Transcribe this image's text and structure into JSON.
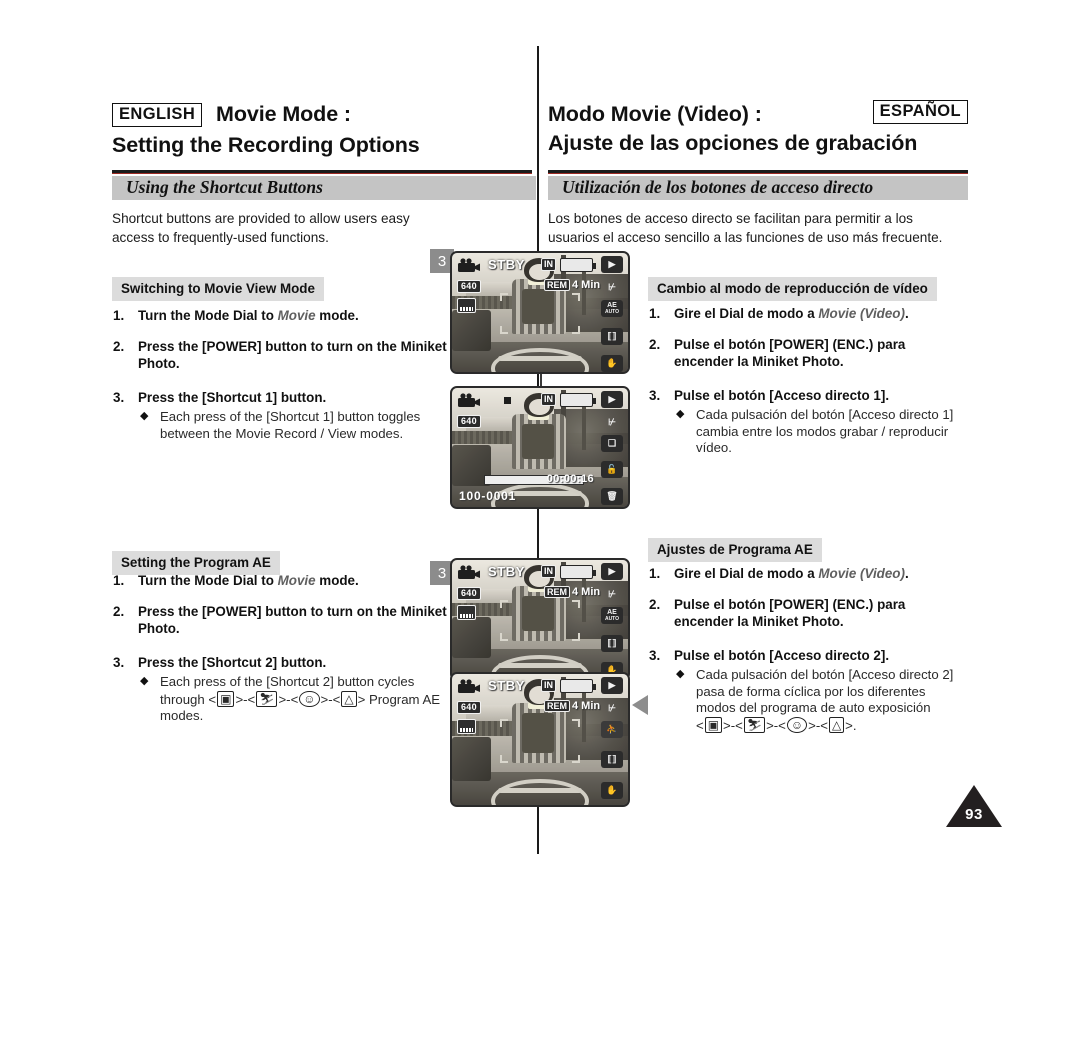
{
  "page": {
    "number": "93"
  },
  "english": {
    "lang_tag": "ENGLISH",
    "title_line1": "Movie Mode :",
    "title_line2": "Setting the Recording Options",
    "section_bar": "Using the Shortcut Buttons",
    "intro": "Shortcut buttons are provided to allow users easy access to frequently-used functions.",
    "sub1": {
      "heading": "Switching to Movie View Mode",
      "steps": [
        {
          "num": "1.",
          "pre": "Turn the Mode Dial to ",
          "em": "Movie",
          "post": " mode."
        },
        {
          "num": "2.",
          "pre": "Press the [POWER] button to turn on the Miniket Photo.",
          "em": "",
          "post": ""
        },
        {
          "num": "3.",
          "pre": "Press the [Shortcut 1] button.",
          "em": "",
          "post": "",
          "bullet": "Each press of the [Shortcut 1] button toggles between the Movie Record / View modes."
        }
      ]
    },
    "sub2": {
      "heading": "Setting the Program AE",
      "steps": [
        {
          "num": "1.",
          "pre": "Turn the Mode Dial to ",
          "em": "Movie",
          "post": " mode."
        },
        {
          "num": "2.",
          "pre": "Press the [POWER] button to turn on the Miniket Photo.",
          "em": "",
          "post": ""
        },
        {
          "num": "3.",
          "pre": "Press the [Shortcut 2] button.",
          "em": "",
          "post": "",
          "bullet_a": "Each press of the [Shortcut 2] button cycles",
          "bullet_b": "through",
          "bullet_c": "Program AE",
          "bullet_d": "modes."
        }
      ]
    }
  },
  "spanish": {
    "lang_tag": "ESPAÑOL",
    "title_line1": "Modo Movie (Video) :",
    "title_line2": "Ajuste de las opciones de grabación",
    "section_bar": "Utilización de los botones de acceso directo",
    "intro": "Los botones de acceso directo se facilitan para permitir a los usuarios el acceso sencillo a las funciones de uso más frecuente.",
    "sub1": {
      "heading": "Cambio al modo de reproducción de vídeo",
      "steps": [
        {
          "num": "1.",
          "pre": "Gire el Dial de modo a ",
          "em": "Movie (Video)",
          "post": "."
        },
        {
          "num": "2.",
          "pre": "Pulse el botón [POWER] (ENC.) para encender la Miniket Photo.",
          "em": "",
          "post": ""
        },
        {
          "num": "3.",
          "pre": "Pulse el botón [Acceso directo 1].",
          "em": "",
          "post": "",
          "bullet": "Cada pulsación del botón [Acceso directo 1] cambia entre los modos grabar / reproducir vídeo."
        }
      ]
    },
    "sub2": {
      "heading": "Ajustes de Programa AE",
      "steps": [
        {
          "num": "1.",
          "pre": "Gire el Dial de modo a ",
          "em": "Movie (Video)",
          "post": "."
        },
        {
          "num": "2.",
          "pre": "Pulse el botón [POWER] (ENC.) para encender la Miniket Photo.",
          "em": "",
          "post": ""
        },
        {
          "num": "3.",
          "pre": "Pulse el botón [Acceso directo 2].",
          "em": "",
          "post": "",
          "bullet_a": "Cada pulsación del botón [Acceso directo 2]",
          "bullet_b": "pasa de forma cíclica por los diferentes",
          "bullet_c": "modos del programa de auto exposición",
          "bullet_d": "."
        }
      ]
    }
  },
  "program_ae_glyphs": {
    "auto": "auto-program-icon",
    "sports": "sports-icon",
    "spotlight": "spotlight-icon",
    "sand_snow": "sand-snow-icon",
    "sep": ">-<",
    "open": "<",
    "close": ">"
  },
  "lcd": [
    {
      "id": "lcd-movie-record-standby",
      "badge": "3",
      "status": "STBY",
      "resolution": "640",
      "remaining_label": "REM",
      "remaining_value": "4 Min",
      "mem_label": "IN",
      "rail": [
        "play-icon",
        "zoom-mic-icon",
        "AE",
        "focus-icon",
        "hand-icon"
      ],
      "ae_label": "AE",
      "ae_sub": "AUTO"
    },
    {
      "id": "lcd-movie-view-playback",
      "badge": "",
      "status": "",
      "resolution": "640",
      "file_number": "100-0001",
      "timecode": "00:00:16",
      "mem_label": "IN",
      "rail": [
        "play-icon",
        "zoom-mic-icon",
        "multi-copy-icon",
        "unlock-icon",
        "trash-icon"
      ]
    },
    {
      "id": "lcd-program-ae-auto",
      "badge": "3",
      "status": "STBY",
      "resolution": "640",
      "remaining_label": "REM",
      "remaining_value": "4 Min",
      "mem_label": "IN",
      "rail": [
        "play-icon",
        "zoom-mic-icon",
        "AE",
        "focus-icon",
        "hand-icon"
      ],
      "ae_label": "AE",
      "ae_sub": "AUTO"
    },
    {
      "id": "lcd-program-ae-sports",
      "badge": "",
      "status": "STBY",
      "resolution": "640",
      "remaining_label": "REM",
      "remaining_value": "4 Min",
      "mem_label": "IN",
      "rail": [
        "play-icon",
        "zoom-mic-icon",
        "sports-icon",
        "focus-icon",
        "hand-icon"
      ]
    }
  ]
}
